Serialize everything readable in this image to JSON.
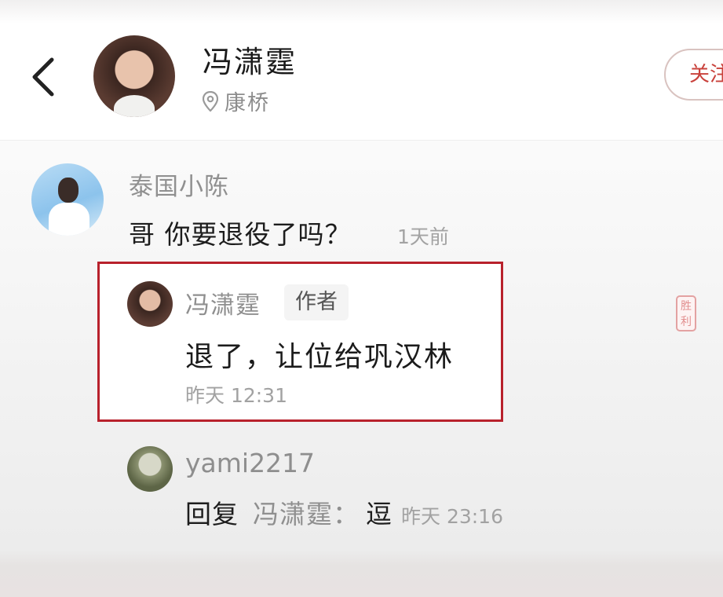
{
  "header": {
    "title": "冯潇霆",
    "location": "康桥",
    "follow_label": "关注"
  },
  "comment": {
    "author": "泰国小陈",
    "text": "哥 你要退役了吗？",
    "time": "1天前"
  },
  "reply": {
    "author": "冯潇霆",
    "badge": "作者",
    "text": "退了，让位给巩汉林",
    "time": "昨天 12:31"
  },
  "second_reply": {
    "author": "yami2217",
    "reply_label": "回复",
    "target": "冯潇霆：",
    "text": "逗",
    "time": "昨天 23:16"
  },
  "seal": {
    "text": "胜利"
  },
  "icons": {
    "back": "chevron-left-icon",
    "location": "location-pin-icon"
  },
  "colors": {
    "highlight_border": "#b8212c",
    "follow_text": "#c9413b"
  }
}
